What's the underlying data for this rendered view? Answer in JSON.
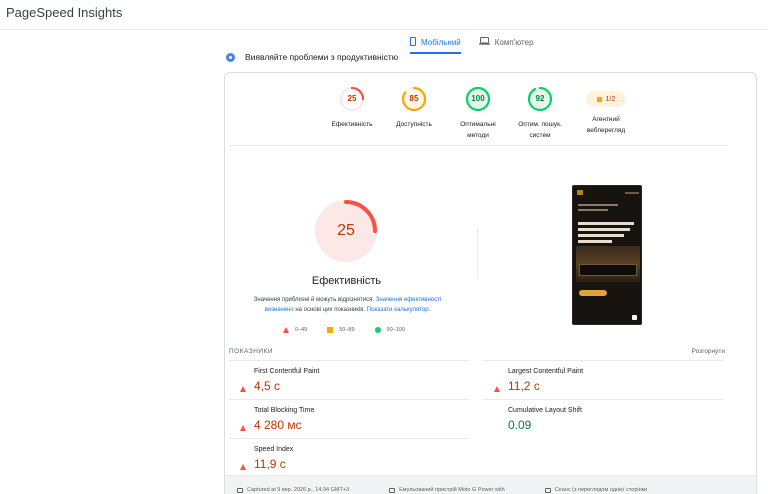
{
  "app": {
    "title": "PageSpeed Insights"
  },
  "tabs": [
    {
      "label": "Мобільний",
      "icon": "smartphone-icon",
      "active": true
    },
    {
      "label": "Комп'ютер",
      "icon": "laptop-icon",
      "active": false
    }
  ],
  "diagnose_heading": "Виявляйте проблеми з продуктивністю",
  "categories": [
    {
      "label_line1": "Ефективність",
      "label_line2": "",
      "score": "25",
      "score_num": 25,
      "status": "fail"
    },
    {
      "label_line1": "Доступність",
      "label_line2": "",
      "score": "85",
      "score_num": 85,
      "status": "average"
    },
    {
      "label_line1": "Оптимальні",
      "label_line2": "методи",
      "score": "100",
      "score_num": 100,
      "status": "pass"
    },
    {
      "label_line1": "Оптим. пошук.",
      "label_line2": "систем",
      "score": "92",
      "score_num": 92,
      "status": "pass"
    },
    {
      "label_line1": "Агентний",
      "label_line2": "вебперегляд",
      "score": "1/2",
      "status": "pwa"
    }
  ],
  "performance": {
    "score": "25",
    "score_num": 25,
    "title": "Ефективність",
    "explain_prefix": "Значення приблизні й можуть відрізнятися.",
    "explain_link1": "Значення ефективності визначено",
    "explain_middle": "на основі цих показників.",
    "explain_link2": "Показати калькулятор."
  },
  "legend": [
    {
      "range": "0–49",
      "shape": "triangle",
      "color": "#ff4e42"
    },
    {
      "range": "50–89",
      "shape": "square",
      "color": "#ffa400"
    },
    {
      "range": "90–100",
      "shape": "circle",
      "color": "#0cce6b"
    }
  ],
  "metrics_section": {
    "title": "ПОКАЗНИКИ",
    "expand_label": "Розгорнути"
  },
  "metrics": [
    {
      "name": "First Contentful Paint",
      "value": "4,5 с",
      "status": "fail"
    },
    {
      "name": "Largest Contentful Paint",
      "value": "11,2 с",
      "status": "fail"
    },
    {
      "name": "Total Blocking Time",
      "value": "4 280 мс",
      "status": "fail"
    },
    {
      "name": "Cumulative Layout Shift",
      "value": "0.09",
      "status": "pass"
    },
    {
      "name": "Speed Index",
      "value": "11,9 с",
      "status": "fail"
    }
  ],
  "footer": [
    {
      "icon": "calendar-icon",
      "text": "Captured at 9 вер. 2026 р., 14:34 GMT+3"
    },
    {
      "icon": "device-icon",
      "text": "Емульований пристрій Moto G Power with"
    },
    {
      "icon": "session-icon",
      "text": "Сеанс (з переглядом однієї сторінки"
    }
  ],
  "colors": {
    "fail": "#ff4e42",
    "fail_text": "#c33300",
    "average": "#ffa400",
    "average_text": "#c33300",
    "pass": "#0cce6b",
    "pass_text": "#018642",
    "accent": "#1a73e8"
  }
}
